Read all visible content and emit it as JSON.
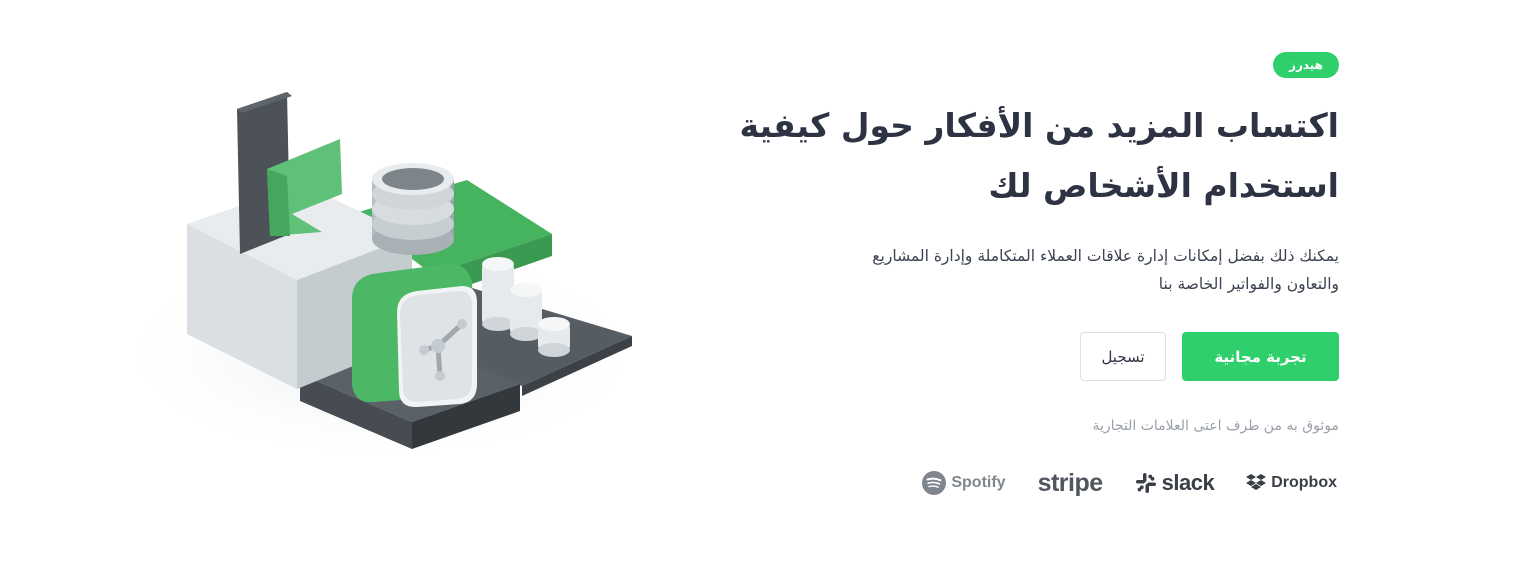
{
  "hero": {
    "badge": "هيدرز",
    "title_line1": "اكتساب المزيد من الأفكار حول كيفية",
    "title_line2": "استخدام الأشخاص لك",
    "description_line1": "يمكنك ذلك بفضل إمكانات إدارة علاقات العملاء المتكاملة وإدارة المشاريع",
    "description_line2": "والتعاون والفواتير الخاصة بنا",
    "primary_button": "تجربة مجانية",
    "secondary_button": "تسجيل",
    "trusted_text": "موثوق به من طرف اعتى العلامات التجارية"
  },
  "logos": [
    {
      "name": "Dropbox",
      "icon": "dropbox-icon"
    },
    {
      "name": "slack",
      "icon": "slack-icon"
    },
    {
      "name": "stripe",
      "icon": ""
    },
    {
      "name": "Spotify",
      "icon": "spotify-icon"
    }
  ],
  "colors": {
    "accent": "#2fcf6b",
    "text": "#2d3342",
    "muted": "#9aa0a8",
    "dark_gray": "#474d52",
    "light_gray": "#dfe4e7"
  }
}
